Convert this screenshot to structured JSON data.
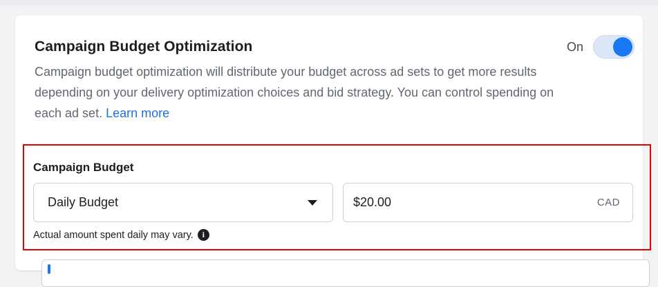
{
  "cbo": {
    "title": "Campaign Budget Optimization",
    "toggle_label": "On",
    "description": "Campaign budget optimization will distribute your budget across ad sets to get more results depending on your delivery optimization choices and bid strategy. You can control spending on each ad set.",
    "learn_more": "Learn more"
  },
  "budget": {
    "heading": "Campaign Budget",
    "type_value": "Daily Budget",
    "amount_value": "$20.00",
    "currency": "CAD",
    "helper_text": "Actual amount spent daily may vary.",
    "info_icon": "i"
  },
  "icons": {
    "dropdown": "caret-down-icon",
    "info": "info-icon"
  },
  "colors": {
    "accent": "#1877f2",
    "link": "#216fdb",
    "highlight": "#e60000"
  }
}
